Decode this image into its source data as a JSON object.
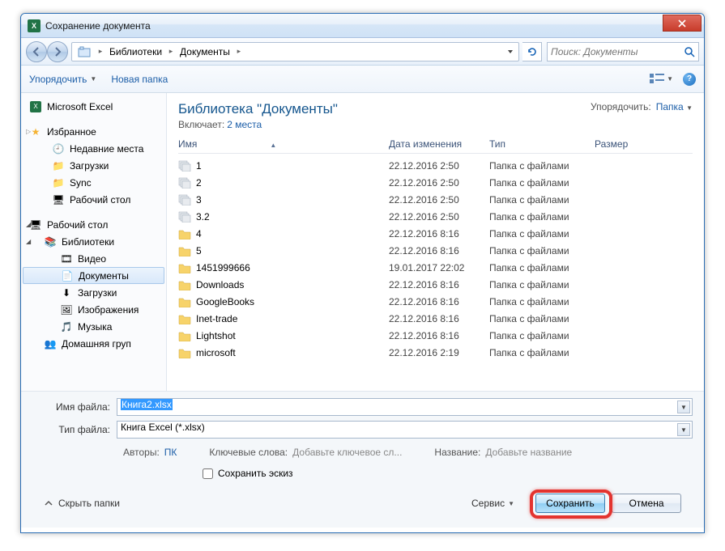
{
  "window": {
    "title": "Сохранение документа",
    "appIconLetter": "X"
  },
  "breadcrumb": {
    "seg1": "Библиотеки",
    "seg2": "Документы"
  },
  "search": {
    "placeholder": "Поиск: Документы"
  },
  "toolbar": {
    "organize": "Упорядочить",
    "newFolder": "Новая папка"
  },
  "sidebar": {
    "excel": "Microsoft Excel",
    "favorites": "Избранное",
    "recent": "Недавние места",
    "downloads": "Загрузки",
    "sync": "Sync",
    "desktop1": "Рабочий стол",
    "desktop2": "Рабочий стол",
    "libraries": "Библиотеки",
    "video": "Видео",
    "documents": "Документы",
    "downloads2": "Загрузки",
    "images": "Изображения",
    "music": "Музыка",
    "homegroup": "Домашняя груп"
  },
  "library": {
    "title": "Библиотека \"Документы\"",
    "includesLabel": "Включает:",
    "includesLink": "2 места",
    "arrangeLabel": "Упорядочить:",
    "arrangeValue": "Папка"
  },
  "columns": {
    "name": "Имя",
    "date": "Дата изменения",
    "type": "Тип",
    "size": "Размер"
  },
  "files": [
    {
      "name": "1",
      "date": "22.12.2016 2:50",
      "type": "Папка с файлами",
      "icon": "cascade"
    },
    {
      "name": "2",
      "date": "22.12.2016 2:50",
      "type": "Папка с файлами",
      "icon": "cascade"
    },
    {
      "name": "3",
      "date": "22.12.2016 2:50",
      "type": "Папка с файлами",
      "icon": "cascade"
    },
    {
      "name": "3.2",
      "date": "22.12.2016 2:50",
      "type": "Папка с файлами",
      "icon": "cascade"
    },
    {
      "name": "4",
      "date": "22.12.2016 8:16",
      "type": "Папка с файлами",
      "icon": "folder"
    },
    {
      "name": "5",
      "date": "22.12.2016 8:16",
      "type": "Папка с файлами",
      "icon": "folder"
    },
    {
      "name": "1451999666",
      "date": "19.01.2017 22:02",
      "type": "Папка с файлами",
      "icon": "folder"
    },
    {
      "name": "Downloads",
      "date": "22.12.2016 8:16",
      "type": "Папка с файлами",
      "icon": "folder"
    },
    {
      "name": "GoogleBooks",
      "date": "22.12.2016 8:16",
      "type": "Папка с файлами",
      "icon": "folder"
    },
    {
      "name": "Inet-trade",
      "date": "22.12.2016 8:16",
      "type": "Папка с файлами",
      "icon": "folder"
    },
    {
      "name": "Lightshot",
      "date": "22.12.2016 8:16",
      "type": "Папка с файлами",
      "icon": "folder"
    },
    {
      "name": "microsoft",
      "date": "22.12.2016 2:19",
      "type": "Папка с файлами",
      "icon": "folder"
    }
  ],
  "form": {
    "filenameLabel": "Имя файла:",
    "filenameValue": "Книга2.xlsx",
    "typeLabel": "Тип файла:",
    "typeValue": "Книга Excel (*.xlsx)"
  },
  "meta": {
    "authorsLabel": "Авторы:",
    "authorsValue": "ПК",
    "keywordsLabel": "Ключевые слова:",
    "keywordsValue": "Добавьте ключевое сл...",
    "titleLabel": "Название:",
    "titleValue": "Добавьте название"
  },
  "checkbox": {
    "label": "Сохранить эскиз"
  },
  "footer": {
    "hideFolders": "Скрыть папки",
    "service": "Сервис",
    "save": "Сохранить",
    "cancel": "Отмена"
  },
  "helpGlyph": "?"
}
